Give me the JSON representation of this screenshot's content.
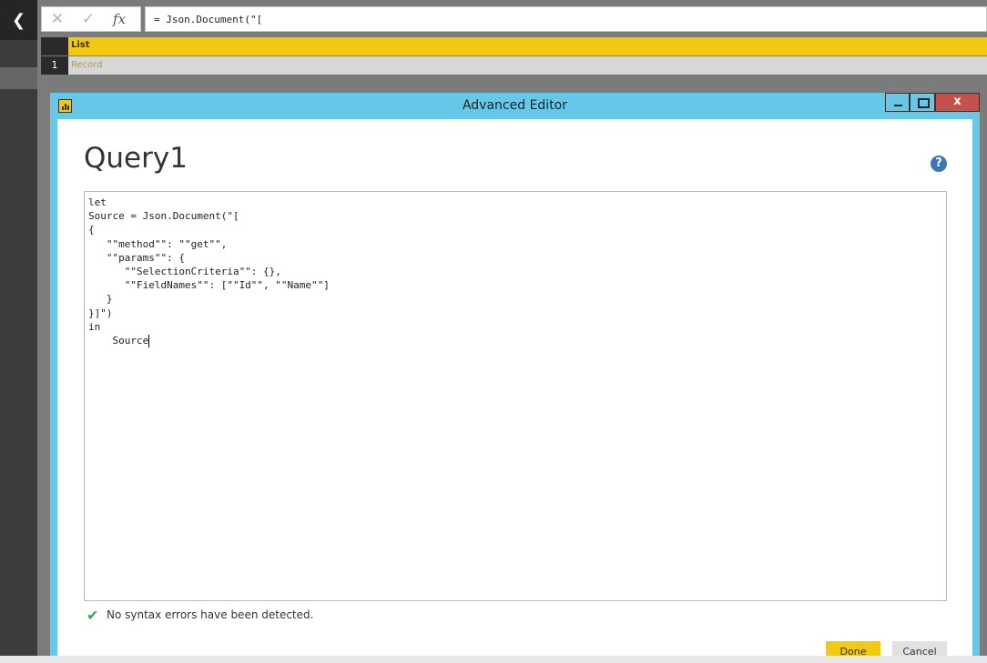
{
  "formula_bar": {
    "cancel_icon": "x-icon",
    "commit_icon": "check-icon",
    "fx_label": "fx",
    "formula": "= Json.Document(\"["
  },
  "grid": {
    "column_header": "List",
    "rows": [
      {
        "num": "1",
        "value": "Record"
      }
    ]
  },
  "dialog": {
    "title": "Advanced Editor",
    "close_label": "x",
    "query_name": "Query1",
    "help_label": "?",
    "code_lines": [
      "let",
      "Source = Json.Document(\"[",
      "{",
      "   \"\"method\"\": \"\"get\"\",",
      "   \"\"params\"\": {",
      "      \"\"SelectionCriteria\"\": {},",
      "      \"\"FieldNames\"\": [\"\"Id\"\", \"\"Name\"\"]",
      "   }",
      "}]\")",
      "in",
      "    Source"
    ],
    "status_text": "No syntax errors have been detected.",
    "done_label": "Done",
    "cancel_label": "Cancel"
  },
  "colors": {
    "accent_yellow": "#f2c811",
    "dialog_frame": "#65c8e8",
    "close_red": "#c7504b",
    "success_green": "#2fa861"
  }
}
